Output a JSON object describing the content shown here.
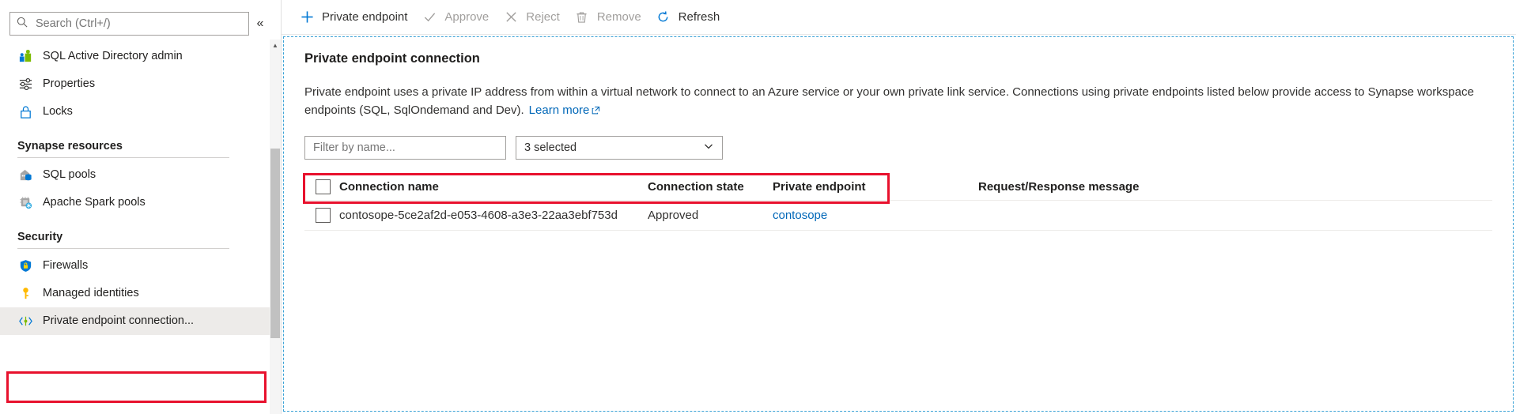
{
  "sidebar": {
    "search": {
      "placeholder": "Search (Ctrl+/)",
      "value": "",
      "icon": "search-icon"
    },
    "collapse_glyph": "«",
    "items": [
      {
        "label": "SQL Active Directory admin",
        "icon": "sql-ad-admin-icon"
      },
      {
        "label": "Properties",
        "icon": "properties-sliders-icon"
      },
      {
        "label": "Locks",
        "icon": "lock-icon"
      }
    ],
    "groups": [
      {
        "title": "Synapse resources",
        "items": [
          {
            "label": "SQL pools",
            "icon": "sql-pools-icon"
          },
          {
            "label": "Apache Spark pools",
            "icon": "spark-pools-icon"
          }
        ]
      },
      {
        "title": "Security",
        "items": [
          {
            "label": "Firewalls",
            "icon": "firewall-shield-icon"
          },
          {
            "label": "Managed identities",
            "icon": "key-icon"
          },
          {
            "label": "Private endpoint connection...",
            "icon": "private-endpoint-icon",
            "selected": true
          }
        ]
      }
    ]
  },
  "toolbar": {
    "buttons": [
      {
        "label": "Private endpoint",
        "icon": "plus-icon",
        "disabled": false
      },
      {
        "label": "Approve",
        "icon": "check-icon",
        "disabled": true
      },
      {
        "label": "Reject",
        "icon": "x-icon",
        "disabled": true
      },
      {
        "label": "Remove",
        "icon": "trash-icon",
        "disabled": true
      },
      {
        "label": "Refresh",
        "icon": "refresh-icon",
        "disabled": false
      }
    ]
  },
  "main": {
    "title": "Private endpoint connection",
    "description": "Private endpoint uses a private IP address from within a virtual network to connect to an Azure service or your own private link service. Connections using private endpoints listed below provide access to Synapse workspace endpoints (SQL, SqlOndemand and Dev).",
    "learn_more": "Learn more",
    "filter": {
      "placeholder": "Filter by name...",
      "value": ""
    },
    "state_select": {
      "value": "3 selected",
      "chevron": "chevron-down-icon"
    },
    "table": {
      "columns": [
        "Connection name",
        "Connection state",
        "Private endpoint",
        "Request/Response message"
      ],
      "rows": [
        {
          "name": "contosope-5ce2af2d-e053-4608-a3e3-22aa3ebf753d",
          "state": "Approved",
          "endpoint": "contosope",
          "message": ""
        }
      ]
    }
  },
  "colors": {
    "accent_link": "#0067b8",
    "highlight_red": "#e8112d",
    "focus_dashed": "#3ba2d6",
    "selected_bg": "#edebe9"
  }
}
